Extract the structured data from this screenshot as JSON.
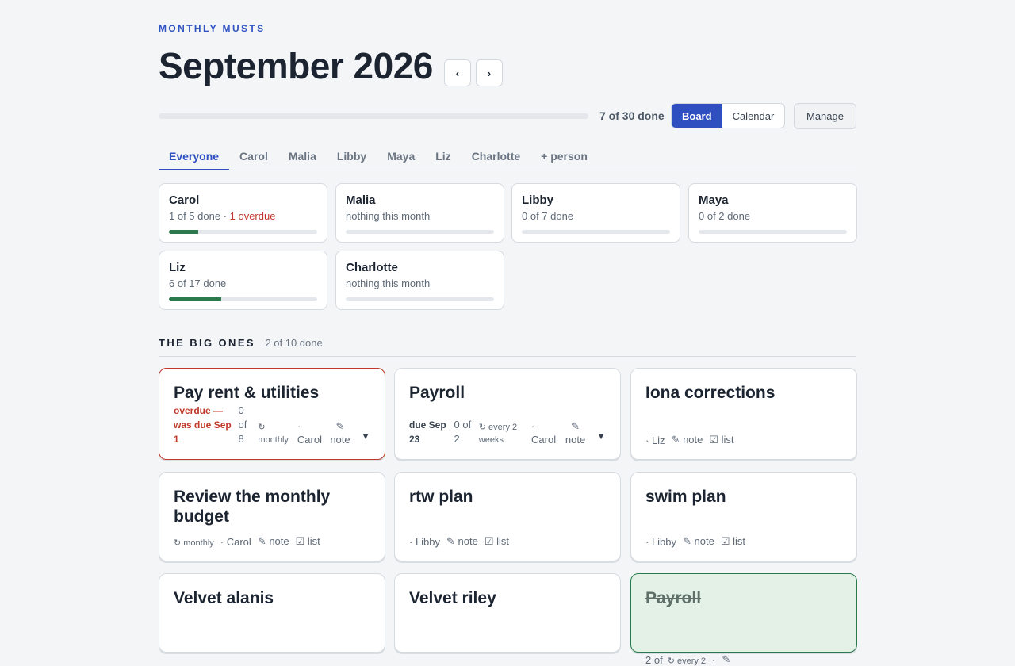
{
  "header": {
    "eyebrow": "MONTHLY MUSTS",
    "title": "September 2026",
    "prev_label": "‹",
    "next_label": "›"
  },
  "progress": {
    "done_text": "7 of 30 done",
    "fraction": 0.0
  },
  "views": {
    "board_label": "Board",
    "calendar_label": "Calendar",
    "active": "Board"
  },
  "manage_label": "Manage",
  "tabs": [
    "Everyone",
    "Carol",
    "Malia",
    "Libby",
    "Maya",
    "Liz",
    "Charlotte",
    "+ person"
  ],
  "active_tab": "Everyone",
  "people": [
    {
      "name": "Carol",
      "status": "1 of 5 done",
      "overdue": "1 overdue",
      "progress": 0.2
    },
    {
      "name": "Malia",
      "status": "nothing this month",
      "overdue": "",
      "progress": 0
    },
    {
      "name": "Libby",
      "status": "0 of 7 done",
      "overdue": "",
      "progress": 0
    },
    {
      "name": "Maya",
      "status": "0 of 2 done",
      "overdue": "",
      "progress": 0
    },
    {
      "name": "Liz",
      "status": "6 of 17 done",
      "overdue": "",
      "progress": 0.353
    },
    {
      "name": "Charlotte",
      "status": "nothing this month",
      "overdue": "",
      "progress": 0
    }
  ],
  "section": {
    "title": "THE BIG ONES",
    "count": "2 of 10 done"
  },
  "tasks": [
    {
      "name": "Pay rent & utilities",
      "due": "overdue — was due Sep 1",
      "count": "0 of 8",
      "repeat": "↻ monthly",
      "person": "· Carol",
      "note": "✎ note",
      "list": "",
      "chevron": "▼",
      "state": "overdue"
    },
    {
      "name": "Payroll",
      "due": "due Sep 23",
      "count": "0 of 2",
      "repeat": "↻ every 2 weeks",
      "person": "· Carol",
      "note": "✎ note",
      "list": "",
      "chevron": "▼",
      "state": "normal"
    },
    {
      "name": "Iona corrections",
      "due": "",
      "count": "",
      "repeat": "",
      "person": "· Liz",
      "note": "✎ note",
      "list": "☑ list",
      "chevron": "",
      "state": "normal"
    },
    {
      "name": "Review the monthly budget",
      "due": "",
      "count": "",
      "repeat": "↻ monthly",
      "person": "· Carol",
      "note": "✎ note",
      "list": "☑ list",
      "chevron": "",
      "state": "normal"
    },
    {
      "name": "rtw plan",
      "due": "",
      "count": "",
      "repeat": "",
      "person": "· Libby",
      "note": "✎ note",
      "list": "☑ list",
      "chevron": "",
      "state": "normal"
    },
    {
      "name": "swim plan",
      "due": "",
      "count": "",
      "repeat": "",
      "person": "· Libby",
      "note": "✎ note",
      "list": "☑ list",
      "chevron": "",
      "state": "normal"
    },
    {
      "name": "Velvet alanis",
      "due": "",
      "count": "",
      "repeat": "",
      "person": "",
      "note": "",
      "list": "",
      "chevron": "",
      "state": "normal"
    },
    {
      "name": "Velvet riley",
      "due": "",
      "count": "",
      "repeat": "",
      "person": "",
      "note": "",
      "list": "",
      "chevron": "",
      "state": "normal"
    },
    {
      "name": "Payroll",
      "due": "",
      "count": "2 of",
      "repeat": "↻ every 2",
      "person": "·",
      "note": "✎",
      "list": "",
      "chevron": "",
      "state": "done"
    }
  ],
  "colors": {
    "accent": "#2f4fc0",
    "success": "#2a7a4b",
    "danger": "#c0392b",
    "background": "#f3f5f7"
  }
}
